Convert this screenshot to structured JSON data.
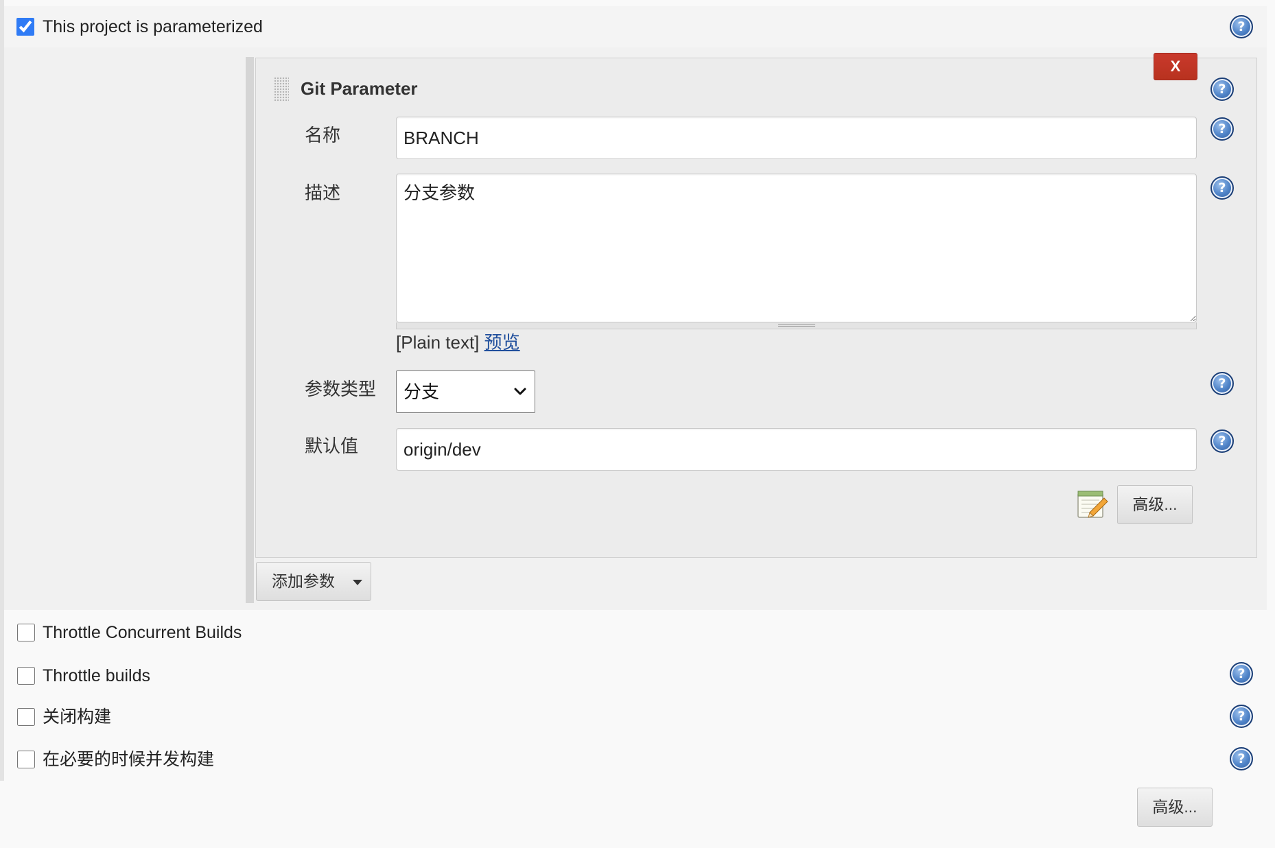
{
  "colors": {
    "accent": "#2f7bf5",
    "delete_button": "#c9392c",
    "link": "#1f4e9c",
    "help_icon": "#3b6db3"
  },
  "icons": {
    "help_glyph": "?",
    "help": "help-icon",
    "drag": "drag-handle-icon",
    "notes": "notepad-icon",
    "dropdown": "chevron-down-icon",
    "caret": "caret-down-icon"
  },
  "parameterized": {
    "label": "This project is parameterized",
    "checked": true
  },
  "git_parameter": {
    "title": "Git Parameter",
    "delete_label": "X",
    "name": {
      "label": "名称",
      "value": "BRANCH"
    },
    "description": {
      "label": "描述",
      "value": "分支参数",
      "format": "[Plain text]",
      "preview_label": "预览"
    },
    "type": {
      "label": "参数类型",
      "selected": "分支"
    },
    "default_value": {
      "label": "默认值",
      "value": "origin/dev"
    },
    "advanced_label": "高级..."
  },
  "add_parameter_label": "添加参数",
  "options": [
    {
      "label": "Throttle Concurrent Builds",
      "checked": false
    },
    {
      "label": "Throttle builds",
      "checked": false
    },
    {
      "label": "关闭构建",
      "checked": false
    },
    {
      "label": "在必要的时候并发构建",
      "checked": false
    }
  ],
  "advanced_label": "高级..."
}
